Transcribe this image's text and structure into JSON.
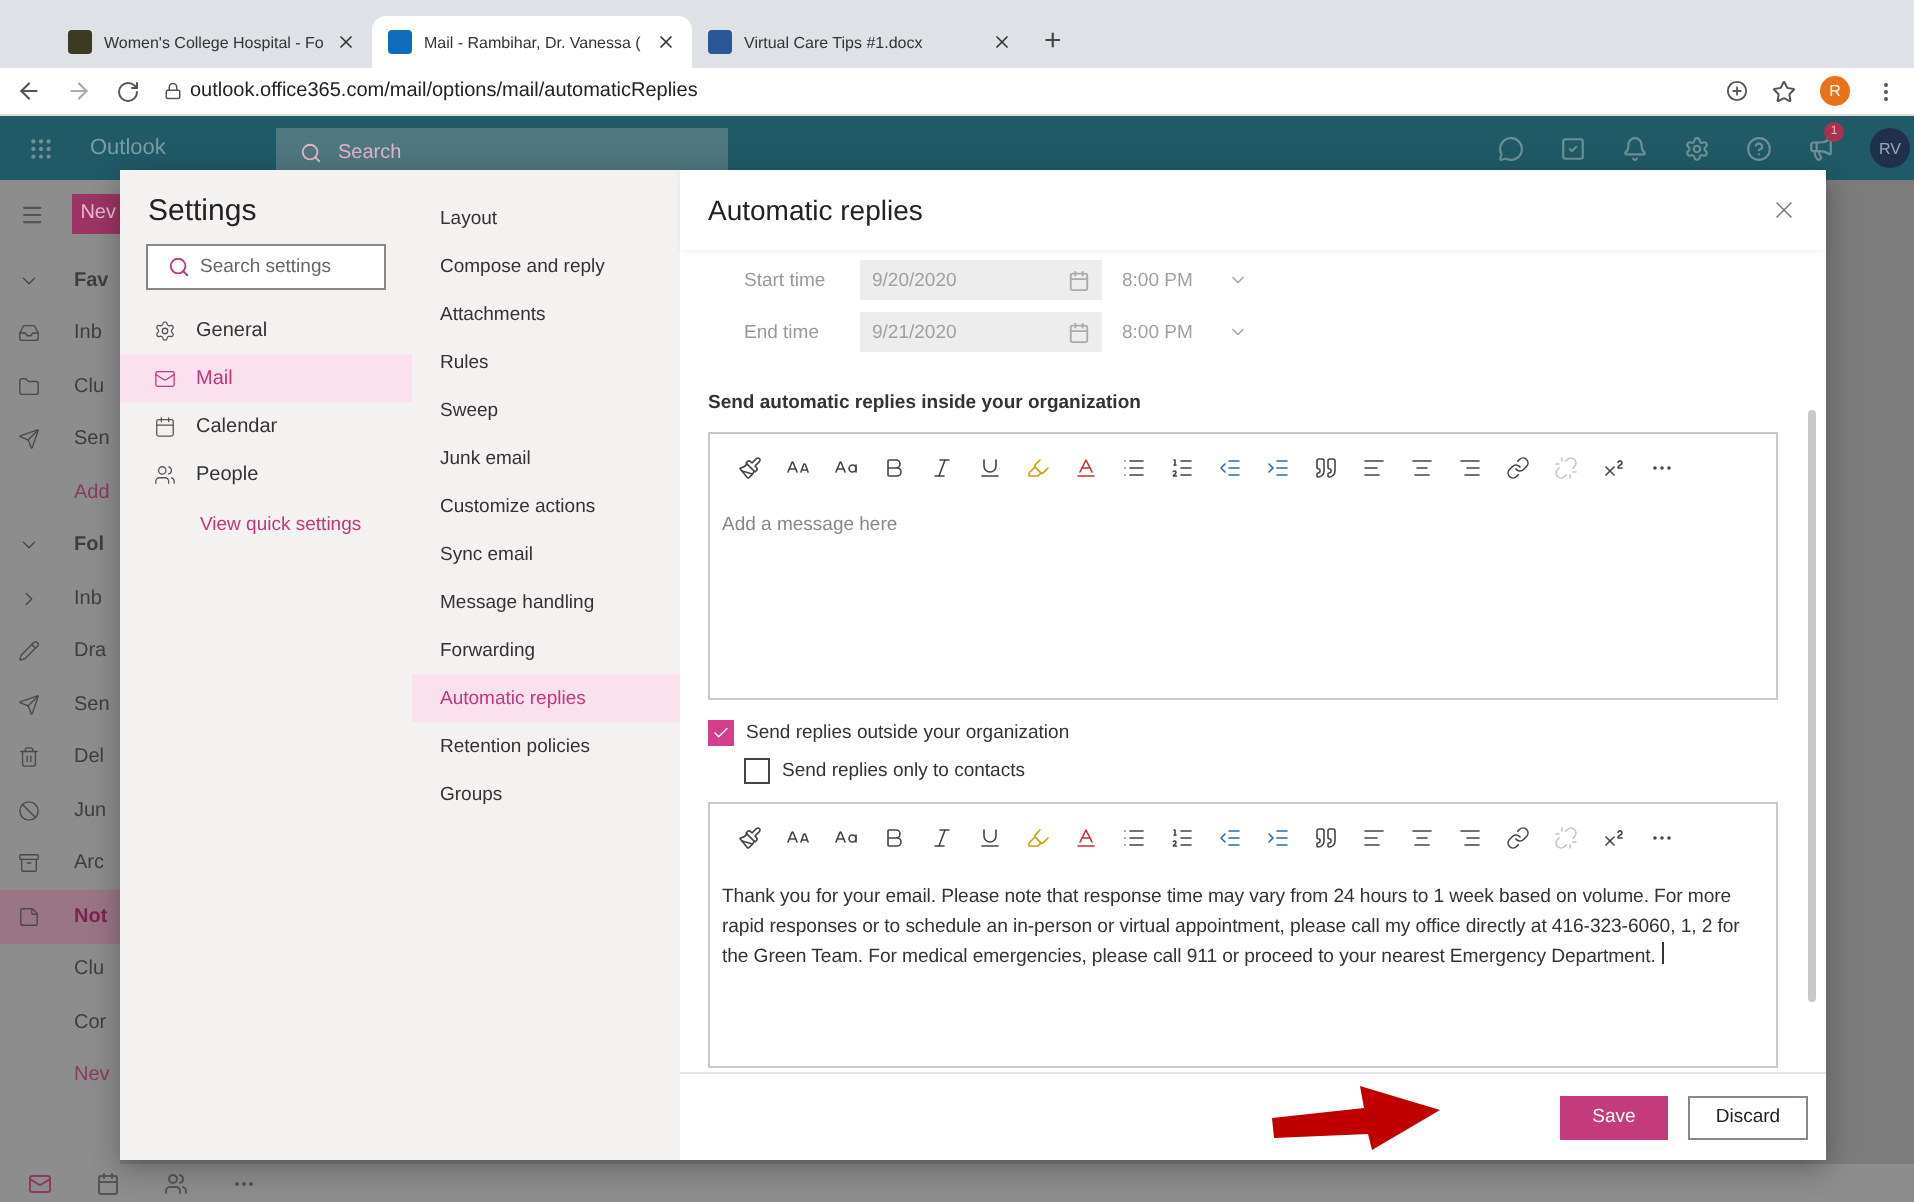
{
  "browser": {
    "tabs": [
      {
        "title": "Women's College Hospital - Fo",
        "kind": "hospital",
        "selected": false
      },
      {
        "title": "Mail - Rambihar, Dr. Vanessa (",
        "kind": "outlook",
        "selected": true
      },
      {
        "title": "Virtual Care Tips #1.docx",
        "kind": "word",
        "selected": false
      }
    ],
    "new_tab": "+",
    "url": "outlook.office365.com/mail/options/mail/automaticReplies",
    "profile": "R"
  },
  "outlook": {
    "app_name": "Outlook",
    "search_placeholder": "Search",
    "notification_count": "1",
    "avatar": "RV",
    "new_button": "Nev",
    "nav": [
      {
        "label": "Fav",
        "kind": "group",
        "selected": false
      },
      {
        "label": "Inb",
        "kind": "inbox",
        "selected": false
      },
      {
        "label": "Clu",
        "kind": "folder",
        "selected": false
      },
      {
        "label": "Sen",
        "kind": "send",
        "selected": false
      },
      {
        "label": "Add",
        "kind": "link",
        "selected": false
      },
      {
        "label": "Fol",
        "kind": "group",
        "selected": false
      },
      {
        "label": "Inb",
        "kind": "subfolder",
        "selected": false
      },
      {
        "label": "Dra",
        "kind": "draft",
        "selected": false
      },
      {
        "label": "Sen",
        "kind": "send",
        "selected": false
      },
      {
        "label": "Del",
        "kind": "trash",
        "selected": false
      },
      {
        "label": "Jun",
        "kind": "junk",
        "selected": false
      },
      {
        "label": "Arc",
        "kind": "archive",
        "selected": false
      },
      {
        "label": "Not",
        "kind": "note",
        "selected": true
      },
      {
        "label": "Clu",
        "kind": "plain",
        "selected": false
      },
      {
        "label": "Cor",
        "kind": "plain",
        "selected": false
      },
      {
        "label": "Nev",
        "kind": "link",
        "selected": false
      }
    ]
  },
  "settings": {
    "title": "Settings",
    "search_placeholder": "Search settings",
    "categories": [
      {
        "label": "General",
        "kind": "general",
        "selected": false
      },
      {
        "label": "Mail",
        "kind": "mail",
        "selected": true
      },
      {
        "label": "Calendar",
        "kind": "calendar",
        "selected": false
      },
      {
        "label": "People",
        "kind": "people",
        "selected": false
      }
    ],
    "quick_settings_link": "View quick settings",
    "pages": [
      {
        "label": "Layout",
        "selected": false
      },
      {
        "label": "Compose and reply",
        "selected": false
      },
      {
        "label": "Attachments",
        "selected": false
      },
      {
        "label": "Rules",
        "selected": false
      },
      {
        "label": "Sweep",
        "selected": false
      },
      {
        "label": "Junk email",
        "selected": false
      },
      {
        "label": "Customize actions",
        "selected": false
      },
      {
        "label": "Sync email",
        "selected": false
      },
      {
        "label": "Message handling",
        "selected": false
      },
      {
        "label": "Forwarding",
        "selected": false
      },
      {
        "label": "Automatic replies",
        "selected": true
      },
      {
        "label": "Retention policies",
        "selected": false
      },
      {
        "label": "Groups",
        "selected": false
      }
    ]
  },
  "panel": {
    "title": "Automatic replies",
    "schedule": [
      {
        "label": "Start time",
        "date": "9/20/2020",
        "time": "8:00 PM"
      },
      {
        "label": "End time",
        "date": "9/21/2020",
        "time": "8:00 PM"
      }
    ],
    "inside_heading": "Send automatic replies inside your organization",
    "inside_editor": {
      "placeholder": "Add a message here",
      "tools": [
        {
          "kind": "paint",
          "disabled": false
        },
        {
          "kind": "font-size",
          "disabled": false
        },
        {
          "kind": "case",
          "disabled": false
        },
        {
          "kind": "bold",
          "disabled": false
        },
        {
          "kind": "italic",
          "disabled": false
        },
        {
          "kind": "underline",
          "disabled": false
        },
        {
          "kind": "highlight",
          "disabled": false
        },
        {
          "kind": "font-color",
          "disabled": false
        },
        {
          "kind": "bullets",
          "disabled": false
        },
        {
          "kind": "numbering",
          "disabled": false
        },
        {
          "kind": "outdent",
          "disabled": false
        },
        {
          "kind": "indent",
          "disabled": false
        },
        {
          "kind": "quote",
          "disabled": false
        },
        {
          "kind": "align-left",
          "disabled": false
        },
        {
          "kind": "align-center",
          "disabled": false
        },
        {
          "kind": "align-right",
          "disabled": false
        },
        {
          "kind": "link",
          "disabled": false
        },
        {
          "kind": "unlink",
          "disabled": true
        },
        {
          "kind": "superscript",
          "disabled": false
        },
        {
          "kind": "more",
          "disabled": false
        }
      ]
    },
    "options": [
      {
        "label": "Send replies outside your organization",
        "checked": true
      },
      {
        "label": "Send replies only to contacts",
        "checked": false
      }
    ],
    "outside_editor": {
      "value": "Thank you for your email. Please note that response time may vary from 24 hours to 1 week based on volume. For more rapid responses or to schedule an in-person or virtual appointment, please call my office directly at 416-323-6060, 1, 2 for the Green Team. For medical emergencies, please call 911 or proceed to your nearest Emergency Department.",
      "tools": [
        {
          "kind": "paint",
          "disabled": false
        },
        {
          "kind": "font-size",
          "disabled": false
        },
        {
          "kind": "case",
          "disabled": false
        },
        {
          "kind": "bold",
          "disabled": false
        },
        {
          "kind": "italic",
          "disabled": false
        },
        {
          "kind": "underline",
          "disabled": false
        },
        {
          "kind": "highlight",
          "disabled": false
        },
        {
          "kind": "font-color",
          "disabled": false
        },
        {
          "kind": "bullets",
          "disabled": false
        },
        {
          "kind": "numbering",
          "disabled": false
        },
        {
          "kind": "outdent",
          "disabled": false
        },
        {
          "kind": "indent",
          "disabled": false
        },
        {
          "kind": "quote",
          "disabled": false
        },
        {
          "kind": "align-left",
          "disabled": false
        },
        {
          "kind": "align-center",
          "disabled": false
        },
        {
          "kind": "align-right",
          "disabled": false
        },
        {
          "kind": "link",
          "disabled": false
        },
        {
          "kind": "unlink",
          "disabled": true
        },
        {
          "kind": "superscript",
          "disabled": false
        },
        {
          "kind": "more",
          "disabled": false
        }
      ]
    },
    "buttons": [
      {
        "label": "Save",
        "kind": "primary"
      },
      {
        "label": "Discard",
        "kind": "secondary"
      }
    ]
  }
}
